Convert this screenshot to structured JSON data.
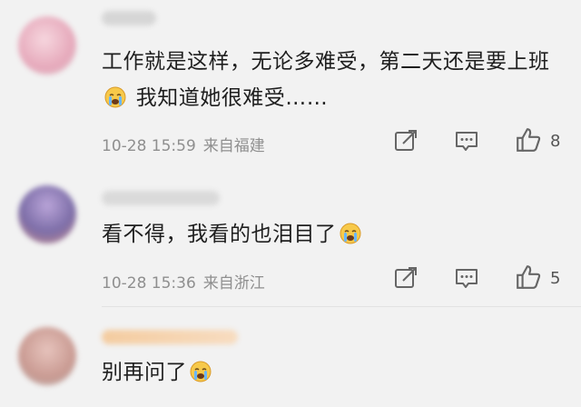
{
  "comments": [
    {
      "content_part1": "工作就是这样，无论多难受，第二天还是要上班",
      "content_part2": " 我知道她很难受……",
      "emoji": "crying-face-emoji",
      "time": "10-28 15:59",
      "location": "来自福建",
      "like_count": "8",
      "avatar_color": "#e9b9c7",
      "username_color": "#d8d8d8"
    },
    {
      "content_part1": "看不得，我看的也泪目了",
      "content_part2": "",
      "emoji": "crying-face-emoji",
      "time": "10-28 15:36",
      "location": "来自浙江",
      "like_count": "5",
      "avatar_color": "#8b7db5",
      "username_color": "#d8d8d8"
    },
    {
      "content_part1": "别再问了",
      "content_part2": "",
      "emoji": "crying-face-emoji",
      "avatar_color": "#d4a7a0",
      "username_color": "#f2cfa8"
    }
  ],
  "icons": {
    "share": "share-icon",
    "comment": "comment-icon",
    "like": "like-icon"
  }
}
